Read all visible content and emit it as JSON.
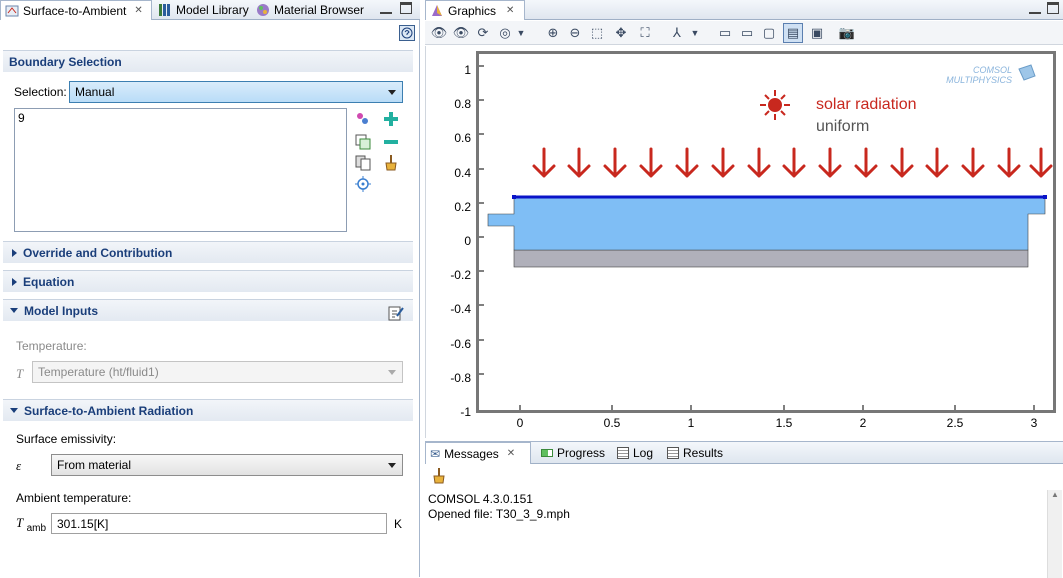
{
  "left_panel": {
    "tabs": [
      {
        "label": "Surface-to-Ambient"
      },
      {
        "label": "Model Library"
      },
      {
        "label": "Material Browser"
      }
    ],
    "boundary_selection": {
      "title": "Boundary Selection",
      "selection_label": "Selection:",
      "selection_value": "Manual",
      "list_items": [
        "9"
      ]
    },
    "override": {
      "title": "Override and Contribution"
    },
    "equation": {
      "title": "Equation"
    },
    "model_inputs": {
      "title": "Model Inputs",
      "temperature_label": "Temperature:",
      "temperature_symbol": "T",
      "temperature_value": "Temperature (ht/fluid1)"
    },
    "radiation": {
      "title": "Surface-to-Ambient Radiation",
      "emissivity_label": "Surface emissivity:",
      "emissivity_symbol": "ε",
      "emissivity_value": "From material",
      "ambient_label": "Ambient temperature:",
      "ambient_symbol": "T",
      "ambient_subscript": "amb",
      "ambient_value": "301.15[K]",
      "ambient_unit": "K"
    }
  },
  "graphics": {
    "tab_label": "Graphics",
    "logo_line1": "COMSOL",
    "logo_line2": "MULTIPHYSICS",
    "annotation_line1": "solar radiation",
    "annotation_line2": "uniform",
    "y_ticks": [
      "1",
      "0.8",
      "0.6",
      "0.4",
      "0.2",
      "0",
      "-0.2",
      "-0.4",
      "-0.6",
      "-0.8",
      "-1"
    ],
    "x_ticks": [
      "0",
      "0.5",
      "1",
      "1.5",
      "2",
      "2.5",
      "3"
    ],
    "colors": {
      "fluid": "#7fbef5",
      "solid": "#b0b0ba",
      "boundary_highlight": "#0a14c8",
      "arrows": "#c8281e"
    }
  },
  "messages": {
    "tabs": [
      {
        "label": "Messages"
      },
      {
        "label": "Progress"
      },
      {
        "label": "Log"
      },
      {
        "label": "Results"
      }
    ],
    "lines": [
      "COMSOL 4.3.0.151",
      "Opened file: T30_3_9.mph"
    ]
  }
}
